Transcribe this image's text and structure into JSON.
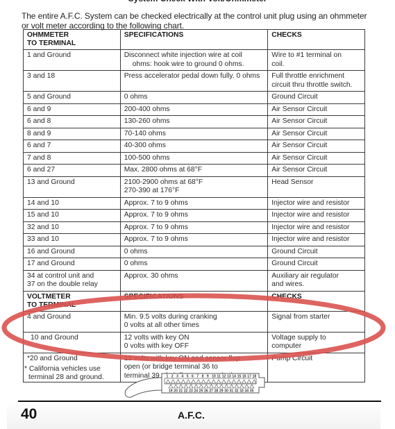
{
  "page_title": "System Check With Volt/Ohmmeter",
  "intro": "The entire A.F.C. System can be checked electrically at the control unit plug using an ohmmeter or volt meter according to the following chart.",
  "ohmmeter_section": {
    "headers": [
      "OHMMETER\nTO TERMINAL",
      "SPECIFICATIONS",
      "CHECKS"
    ],
    "header_col1_line1": "OHMMETER",
    "header_col1_line2": "TO TERMINAL",
    "header_col2": "SPECIFICATIONS",
    "header_col3": "CHECKS",
    "rows": [
      {
        "terminal": "1 and Ground",
        "spec_line1": "Disconnect white injection wire at coil",
        "spec_line2": "ohms: hook wire to ground 0 ohms.",
        "check_line1": "Wire to #1 terminal on",
        "check_line2": "coil."
      },
      {
        "terminal": "3 and 18",
        "spec_line1": "Press accelerator pedal down fully. 0 ohms",
        "check_line1": "Full throttle enrichment",
        "check_line2": "circuit thru throttle switch."
      },
      {
        "terminal": "5 and Ground",
        "spec_line1": "0 ohms",
        "check_line1": "Ground Circuit"
      },
      {
        "terminal": "6 and 9",
        "spec_line1": "200-400 ohms",
        "check_line1": "Air Sensor Circuit"
      },
      {
        "terminal": "6 and 8",
        "spec_line1": "130-260 ohms",
        "check_line1": "Air Sensor Circuit"
      },
      {
        "terminal": "8 and 9",
        "spec_line1": "70-140 ohms",
        "check_line1": "Air Sensor Circuit"
      },
      {
        "terminal": "6 and 7",
        "spec_line1": "40-300 ohms",
        "check_line1": "Air Sensor Circuit"
      },
      {
        "terminal": "7 and 8",
        "spec_line1": "100-500 ohms",
        "check_line1": "Air Sensor Circuit"
      },
      {
        "terminal": "6 and 27",
        "spec_line1": "Max. 2800 ohms at 68°F",
        "check_line1": "Air Sensor Circuit"
      },
      {
        "terminal": "13 and Ground",
        "spec_line1": "2100-2900 ohms at 68°F",
        "spec_line2": "270-390 at 176°F",
        "check_line1": "Head Sensor"
      },
      {
        "terminal": "14 and 10",
        "spec_line1": "Approx. 7 to 9 ohms",
        "check_line1": "Injector wire and resistor"
      },
      {
        "terminal": "15 and 10",
        "spec_line1": "Approx. 7 to 9 ohms",
        "check_line1": "Injector wire and resistor"
      },
      {
        "terminal": "32 and 10",
        "spec_line1": "Approx. 7 to 9 ohms",
        "check_line1": "Injector wire and resistor"
      },
      {
        "terminal": "33 and 10",
        "spec_line1": "Approx. 7 to 9 ohms",
        "check_line1": "Injector wire and resistor"
      },
      {
        "terminal": "16 and Ground",
        "spec_line1": "0 ohms",
        "check_line1": "Ground Circuit"
      },
      {
        "terminal": "17 and Ground",
        "spec_line1": "0 ohms",
        "check_line1": "Ground Circuit"
      },
      {
        "terminal": "34 at control unit and",
        "terminal_line2": "37 on the double relay",
        "spec_line1": "Approx. 30 ohms",
        "check_line1": "Auxiliary air regulator",
        "check_line2": "and wires."
      }
    ]
  },
  "voltmeter_section": {
    "header_col1_line1": "VOLTMETER",
    "header_col1_line2": "TO TERMINAL",
    "header_col2": "SPECIFICATIONS",
    "header_col3": "CHECKS",
    "rows": [
      {
        "terminal": "4 and Ground",
        "spec_line1": "Min. 9.5 volts during cranking",
        "spec_line2": "0 volts at all other times",
        "check_line1": "Signal from starter"
      },
      {
        "terminal": "10 and Ground",
        "spec_line1": "12 volts with key ON",
        "spec_line2": "0 volts with key OFF",
        "check_line1": "Voltage supply to",
        "check_line2": "computer"
      },
      {
        "terminal": "*20 and Ground",
        "spec_line1": "12 volts with key ON and sensor flap",
        "spec_line2": "open (or bridge terminal 36 to",
        "spec_line3": "terminal 39 of air flow sensor plug)",
        "check_line1": "Pump Circuit"
      }
    ]
  },
  "footnote_line1": "* California vehicles use",
  "footnote_line2": "terminal 28 and ground.",
  "connector": {
    "top_pins": [
      "1",
      "2",
      "3",
      "4",
      "5",
      "6",
      "7",
      "8",
      "9",
      "10",
      "11",
      "12",
      "13",
      "14",
      "15",
      "16",
      "17",
      "18"
    ],
    "bottom_pins": [
      "19",
      "20",
      "21",
      "22",
      "23",
      "24",
      "25",
      "26",
      "27",
      "28",
      "29",
      "30",
      "31",
      "32",
      "33",
      "34",
      "35"
    ]
  },
  "footer": {
    "page_number": "40",
    "section_title": "A.F.C."
  },
  "annotation": {
    "type": "hand-drawn ellipse",
    "color": "#d9534f",
    "encircles": [
      "10 and Ground",
      "*20 and Ground"
    ]
  }
}
